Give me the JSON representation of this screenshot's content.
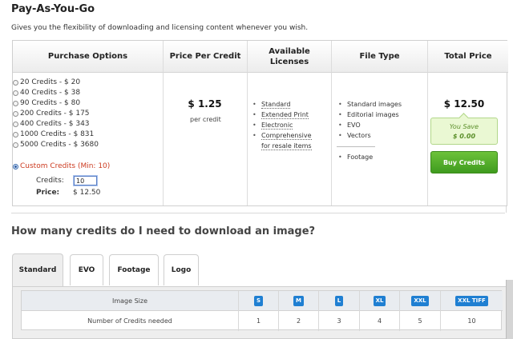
{
  "header": {
    "title": "Pay-As-You-Go",
    "subtitle": "Gives you the flexibility of downloading and licensing content whenever you wish."
  },
  "pricing_table": {
    "headers": {
      "purchase_options": "Purchase Options",
      "price_per_credit": "Price Per Credit",
      "available_licenses_1": "Available",
      "available_licenses_2": "Licenses",
      "file_type": "File Type",
      "total_price": "Total Price"
    },
    "options": [
      "20 Credits - $ 20",
      "40 Credits - $ 38",
      "90 Credits - $ 80",
      "200 Credits - $ 175",
      "400 Credits - $ 343",
      "1000 Credits - $ 831",
      "5000 Credits - $ 3680"
    ],
    "custom": {
      "label": "Custom Credits (Min: 10)",
      "credits_label": "Credits:",
      "credits_value": "10",
      "price_label": "Price:",
      "price_value": "$ 12.50"
    },
    "price_per_credit": {
      "value": "$ 1.25",
      "note": "per credit"
    },
    "licenses": [
      "Standard",
      "Extended Print",
      "Electronic",
      "Comprehensive",
      "for resale items"
    ],
    "file_types": [
      "Standard images",
      "Editorial images",
      "EVO",
      "Vectors"
    ],
    "file_types_extra": [
      "Footage"
    ],
    "total": {
      "value": "$ 12.50",
      "you_save_label": "You Save",
      "you_save_value": "$ 0.00",
      "buy_label": "Buy Credits"
    }
  },
  "credits_section": {
    "title": "How many credits do I need to download an image?",
    "tabs": [
      "Standard",
      "EVO",
      "Footage",
      "Logo"
    ],
    "table": {
      "row1_label": "Image Size",
      "row2_label": "Number of Credits needed",
      "sizes": [
        "S",
        "M",
        "L",
        "XL",
        "XXL",
        "XXL TIFF"
      ],
      "credits": [
        "1",
        "2",
        "3",
        "4",
        "5",
        "10"
      ]
    }
  },
  "colors": {
    "buy_button": "#4aa82a",
    "you_save_bg": "#eaf8d3",
    "custom_label": "#cc3a1f",
    "size_badge": "#1f7fd2"
  }
}
